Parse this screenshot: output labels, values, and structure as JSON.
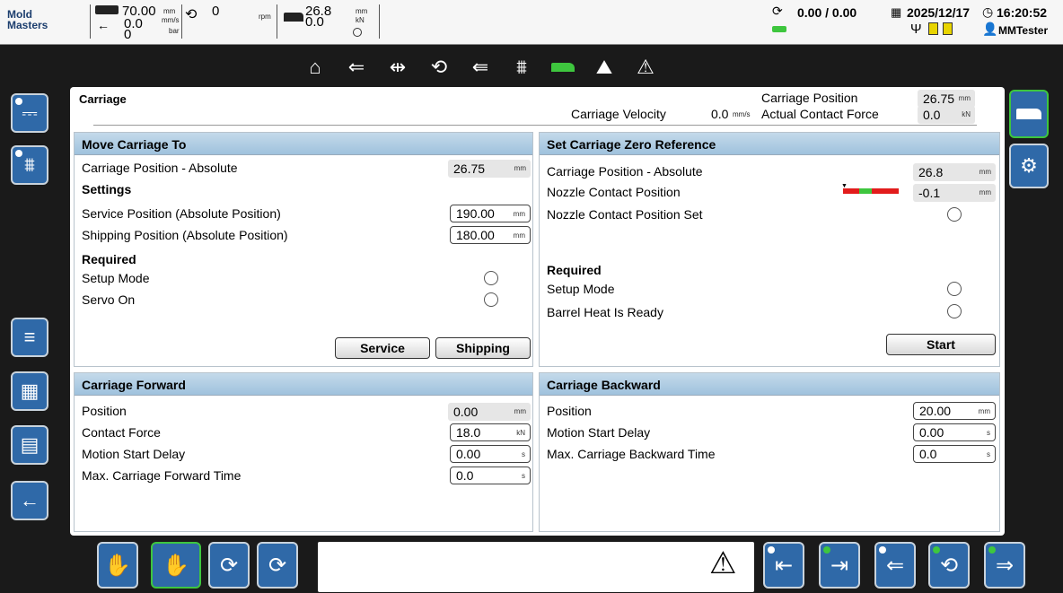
{
  "topbar": {
    "logo_line1": "Mold",
    "logo_line2": "Masters",
    "speed_value": "70.00",
    "speed_unit": "mm",
    "speed2_value": "0.0",
    "speed2_unit": "mm/s",
    "pressure_value": "0",
    "pressure_unit": "bar",
    "screw_value": "0",
    "screw_unit": "rpm",
    "carriage_value": "26.8",
    "carriage_value2": "0.0",
    "carriage_unit": "mm",
    "carriage_unit2": "kN",
    "counter": "0.00 / 0.00",
    "date": "2025/12/17",
    "time": "16:20:52",
    "user": "MMTester"
  },
  "nav": {
    "icons": [
      "home-icon",
      "injection-icon",
      "hold-pressure-icon",
      "plasticize-icon",
      "decompress-icon",
      "heater-icon",
      "carriage-icon",
      "profile-icon",
      "alarm-icon"
    ],
    "active_index": 6
  },
  "left_sidebar": [
    "power-unit-icon",
    "heater-zones-icon",
    "menu-icon",
    "calculator-icon",
    "document-icon",
    "back-arrow-icon"
  ],
  "right_sidebar": [
    "carriage-icon",
    "settings-gears-icon"
  ],
  "page": {
    "title": "Carriage",
    "carriage_position_label": "Carriage Position",
    "carriage_position_value": "26.75",
    "carriage_position_unit": "mm",
    "carriage_velocity_label": "Carriage Velocity",
    "carriage_velocity_value": "0.0",
    "carriage_velocity_unit": "mm/s",
    "actual_force_label": "Actual Contact Force",
    "actual_force_value": "0.0",
    "actual_force_unit": "kN"
  },
  "move": {
    "title": "Move Carriage To",
    "pos_abs_label": "Carriage Position - Absolute",
    "pos_abs_value": "26.75",
    "pos_abs_unit": "mm",
    "settings_label": "Settings",
    "service_label": "Service Position (Absolute Position)",
    "service_value": "190.00",
    "service_unit": "mm",
    "shipping_label": "Shipping Position (Absolute Position)",
    "shipping_value": "180.00",
    "shipping_unit": "mm",
    "required_label": "Required",
    "setup_mode_label": "Setup Mode",
    "servo_on_label": "Servo On",
    "service_button": "Service",
    "shipping_button": "Shipping"
  },
  "zero": {
    "title": "Set Carriage Zero Reference",
    "pos_abs_label": "Carriage Position - Absolute",
    "pos_abs_value": "26.8",
    "pos_abs_unit": "mm",
    "nozzle_label": "Nozzle Contact Position",
    "nozzle_value": "-0.1",
    "nozzle_unit": "mm",
    "nozzle_set_label": "Nozzle Contact Position Set",
    "required_label": "Required",
    "setup_mode_label": "Setup Mode",
    "barrel_label": "Barrel Heat Is Ready",
    "start_button": "Start"
  },
  "forward": {
    "title": "Carriage Forward",
    "position_label": "Position",
    "position_value": "0.00",
    "position_unit": "mm",
    "force_label": "Contact Force",
    "force_value": "18.0",
    "force_unit": "kN",
    "delay_label": "Motion Start Delay",
    "delay_value": "0.00",
    "delay_unit": "s",
    "maxtime_label": "Max. Carriage Forward Time",
    "maxtime_value": "0.0",
    "maxtime_unit": "s"
  },
  "backward": {
    "title": "Carriage Backward",
    "position_label": "Position",
    "position_value": "20.00",
    "position_unit": "mm",
    "delay_label": "Motion Start Delay",
    "delay_value": "0.00",
    "delay_unit": "s",
    "maxtime_label": "Max. Carriage Backward Time",
    "maxtime_value": "0.0",
    "maxtime_unit": "s"
  },
  "colors": {
    "accent": "#2f69a8",
    "active": "#3ec63e",
    "header": "#9fc2dd"
  }
}
